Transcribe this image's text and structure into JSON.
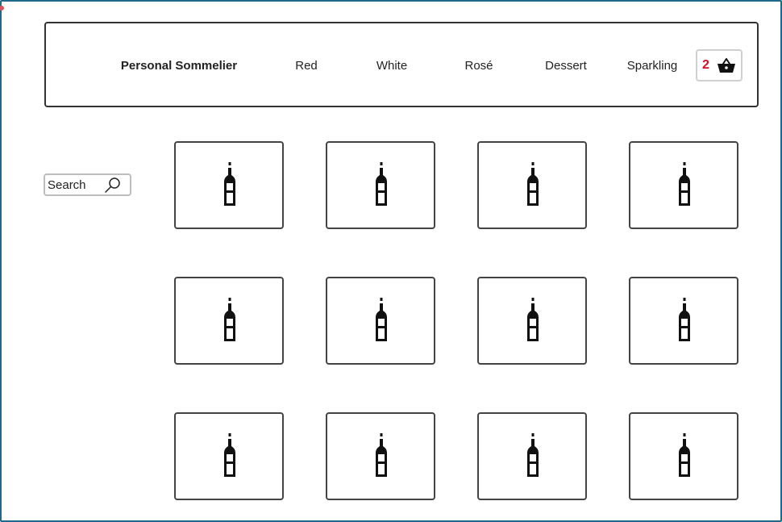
{
  "header": {
    "brand": "Personal Sommelier",
    "nav": [
      {
        "id": "red",
        "label": "Red"
      },
      {
        "id": "white",
        "label": "White"
      },
      {
        "id": "rose",
        "label": "Rosé"
      },
      {
        "id": "dessert",
        "label": "Dessert"
      },
      {
        "id": "sparkling",
        "label": "Sparkling"
      }
    ],
    "cart": {
      "count": "2",
      "icon": "basket-icon",
      "count_color": "#d01020"
    }
  },
  "search": {
    "placeholder": "Search",
    "value": "",
    "icon": "search-icon"
  },
  "products": {
    "icon": "wine-bottle-icon",
    "rows": 3,
    "columns": 4
  },
  "colors": {
    "frame": "#1f6a8a",
    "border": "#333333",
    "cart_count": "#d01020"
  }
}
